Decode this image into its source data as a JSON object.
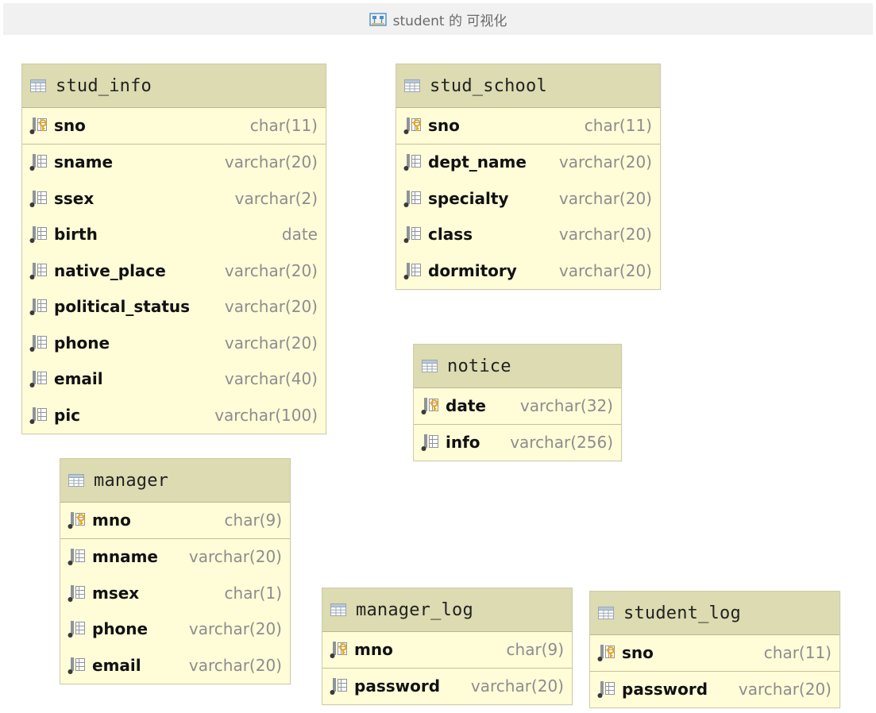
{
  "title": "student 的 可视化",
  "icons": {
    "header": "table-icon",
    "primary_key": "key-column-icon",
    "column": "column-icon",
    "diagram": "diagram-icon"
  },
  "colors": {
    "table_body": "#fffcd8",
    "table_header": "#dcdbb1",
    "key": "#e8a822"
  },
  "tables": [
    {
      "name": "stud_info",
      "columns": [
        {
          "name": "sno",
          "type": "char(11)",
          "pk": true
        },
        {
          "name": "sname",
          "type": "varchar(20)"
        },
        {
          "name": "ssex",
          "type": "varchar(2)"
        },
        {
          "name": "birth",
          "type": "date"
        },
        {
          "name": "native_place",
          "type": "varchar(20)"
        },
        {
          "name": "political_status",
          "type": "varchar(20)"
        },
        {
          "name": "phone",
          "type": "varchar(20)"
        },
        {
          "name": "email",
          "type": "varchar(40)"
        },
        {
          "name": "pic",
          "type": "varchar(100)"
        }
      ]
    },
    {
      "name": "stud_school",
      "columns": [
        {
          "name": "sno",
          "type": "char(11)",
          "pk": true
        },
        {
          "name": "dept_name",
          "type": "varchar(20)"
        },
        {
          "name": "specialty",
          "type": "varchar(20)"
        },
        {
          "name": "class",
          "type": "varchar(20)"
        },
        {
          "name": "dormitory",
          "type": "varchar(20)"
        }
      ]
    },
    {
      "name": "notice",
      "columns": [
        {
          "name": "date",
          "type": "varchar(32)",
          "pk": true
        },
        {
          "name": "info",
          "type": "varchar(256)"
        }
      ]
    },
    {
      "name": "manager",
      "columns": [
        {
          "name": "mno",
          "type": "char(9)",
          "pk": true
        },
        {
          "name": "mname",
          "type": "varchar(20)"
        },
        {
          "name": "msex",
          "type": "char(1)"
        },
        {
          "name": "phone",
          "type": "varchar(20)"
        },
        {
          "name": "email",
          "type": "varchar(20)"
        }
      ]
    },
    {
      "name": "manager_log",
      "columns": [
        {
          "name": "mno",
          "type": "char(9)",
          "pk": true
        },
        {
          "name": "password",
          "type": "varchar(20)"
        }
      ]
    },
    {
      "name": "student_log",
      "columns": [
        {
          "name": "sno",
          "type": "char(11)",
          "pk": true
        },
        {
          "name": "password",
          "type": "varchar(20)"
        }
      ]
    }
  ]
}
